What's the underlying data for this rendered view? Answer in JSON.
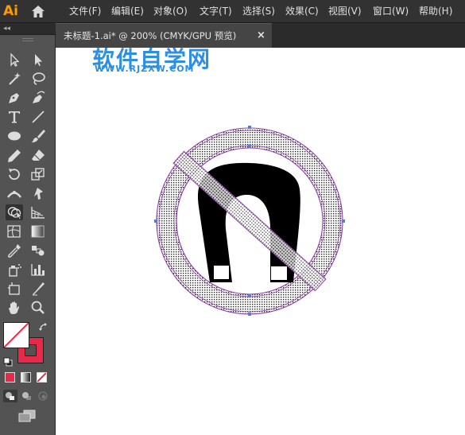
{
  "app": {
    "logo_text": "Ai",
    "logo_color": "#ff9a00",
    "home_icon": "home-icon"
  },
  "menu": [
    {
      "label": "文件(F)"
    },
    {
      "label": "编辑(E)"
    },
    {
      "label": "对象(O)"
    },
    {
      "label": "文字(T)"
    },
    {
      "label": "选择(S)"
    },
    {
      "label": "效果(C)"
    },
    {
      "label": "视图(V)"
    },
    {
      "label": "窗口(W)"
    },
    {
      "label": "帮助(H)"
    }
  ],
  "panel": {
    "collapse_glyph": "◂◂"
  },
  "tools": [
    {
      "name": "selection-tool-icon"
    },
    {
      "name": "direct-selection-tool-icon"
    },
    {
      "name": "magic-wand-tool-icon"
    },
    {
      "name": "lasso-tool-icon"
    },
    {
      "name": "pen-tool-icon"
    },
    {
      "name": "curvature-tool-icon"
    },
    {
      "name": "type-tool-icon"
    },
    {
      "name": "line-segment-tool-icon"
    },
    {
      "name": "ellipse-tool-icon"
    },
    {
      "name": "paintbrush-tool-icon"
    },
    {
      "name": "pencil-tool-icon"
    },
    {
      "name": "eraser-tool-icon"
    },
    {
      "name": "rotate-tool-icon"
    },
    {
      "name": "scale-tool-icon"
    },
    {
      "name": "width-tool-icon"
    },
    {
      "name": "puppet-warp-tool-icon"
    },
    {
      "name": "shape-builder-tool-icon",
      "active": true
    },
    {
      "name": "perspective-grid-tool-icon"
    },
    {
      "name": "mesh-tool-icon"
    },
    {
      "name": "gradient-tool-icon"
    },
    {
      "name": "eyedropper-tool-icon"
    },
    {
      "name": "blend-tool-icon"
    },
    {
      "name": "symbol-sprayer-tool-icon"
    },
    {
      "name": "column-graph-tool-icon"
    },
    {
      "name": "artboard-tool-icon"
    },
    {
      "name": "slice-tool-icon"
    },
    {
      "name": "hand-tool-icon"
    },
    {
      "name": "zoom-tool-icon"
    }
  ],
  "colors": {
    "fill": "none",
    "stroke": "#e8294a",
    "path_highlight": "#8e3fa6",
    "watermark": "#2e8fe0"
  },
  "document": {
    "tab_title": "未标题-1.ai* @ 200% (CMYK/GPU 预览)",
    "close_glyph": "×"
  },
  "watermark": {
    "title": "软件自学网",
    "url": "WWW.RJZXW.COM"
  }
}
